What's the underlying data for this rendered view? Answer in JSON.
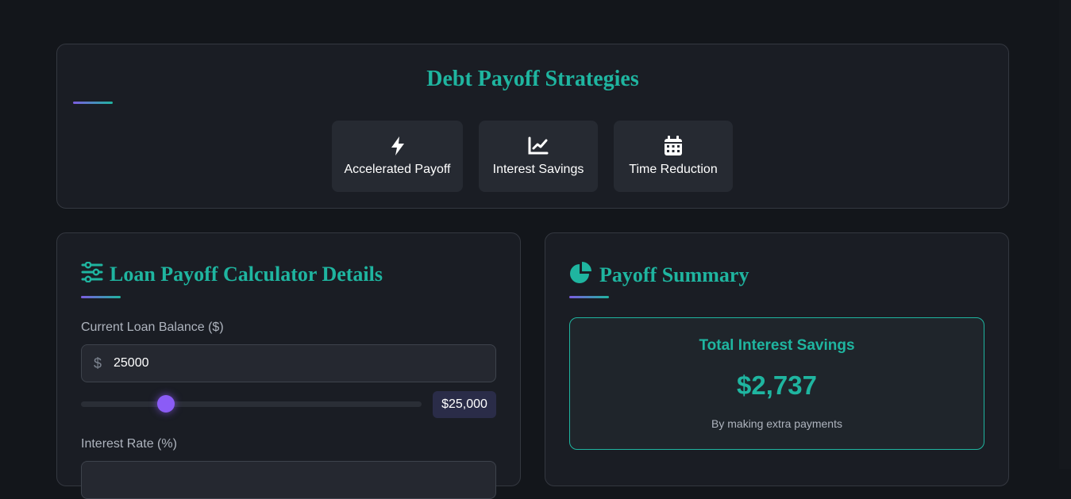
{
  "strategies": {
    "title": "Debt Payoff Strategies",
    "buttons": [
      {
        "label": "Accelerated Payoff",
        "icon": "bolt-icon"
      },
      {
        "label": "Interest Savings",
        "icon": "line-chart-icon"
      },
      {
        "label": "Time Reduction",
        "icon": "calendar-icon"
      }
    ]
  },
  "calculator": {
    "title": "Loan Payoff Calculator Details",
    "icon": "sliders-icon",
    "balance": {
      "label": "Current Loan Balance ($)",
      "prefix": "$",
      "value": "25000",
      "display": "$25,000",
      "slider_fraction": 0.25
    },
    "rate": {
      "label": "Interest Rate (%)"
    }
  },
  "summary": {
    "title": "Payoff Summary",
    "icon": "pie-chart-icon",
    "savings": {
      "title": "Total Interest Savings",
      "amount": "$2,737",
      "caption": "By making extra payments"
    }
  },
  "colors": {
    "accent": "#1fb5a0",
    "purple": "#8b5cf6",
    "background": "#13161b",
    "card": "#1a1d24"
  }
}
